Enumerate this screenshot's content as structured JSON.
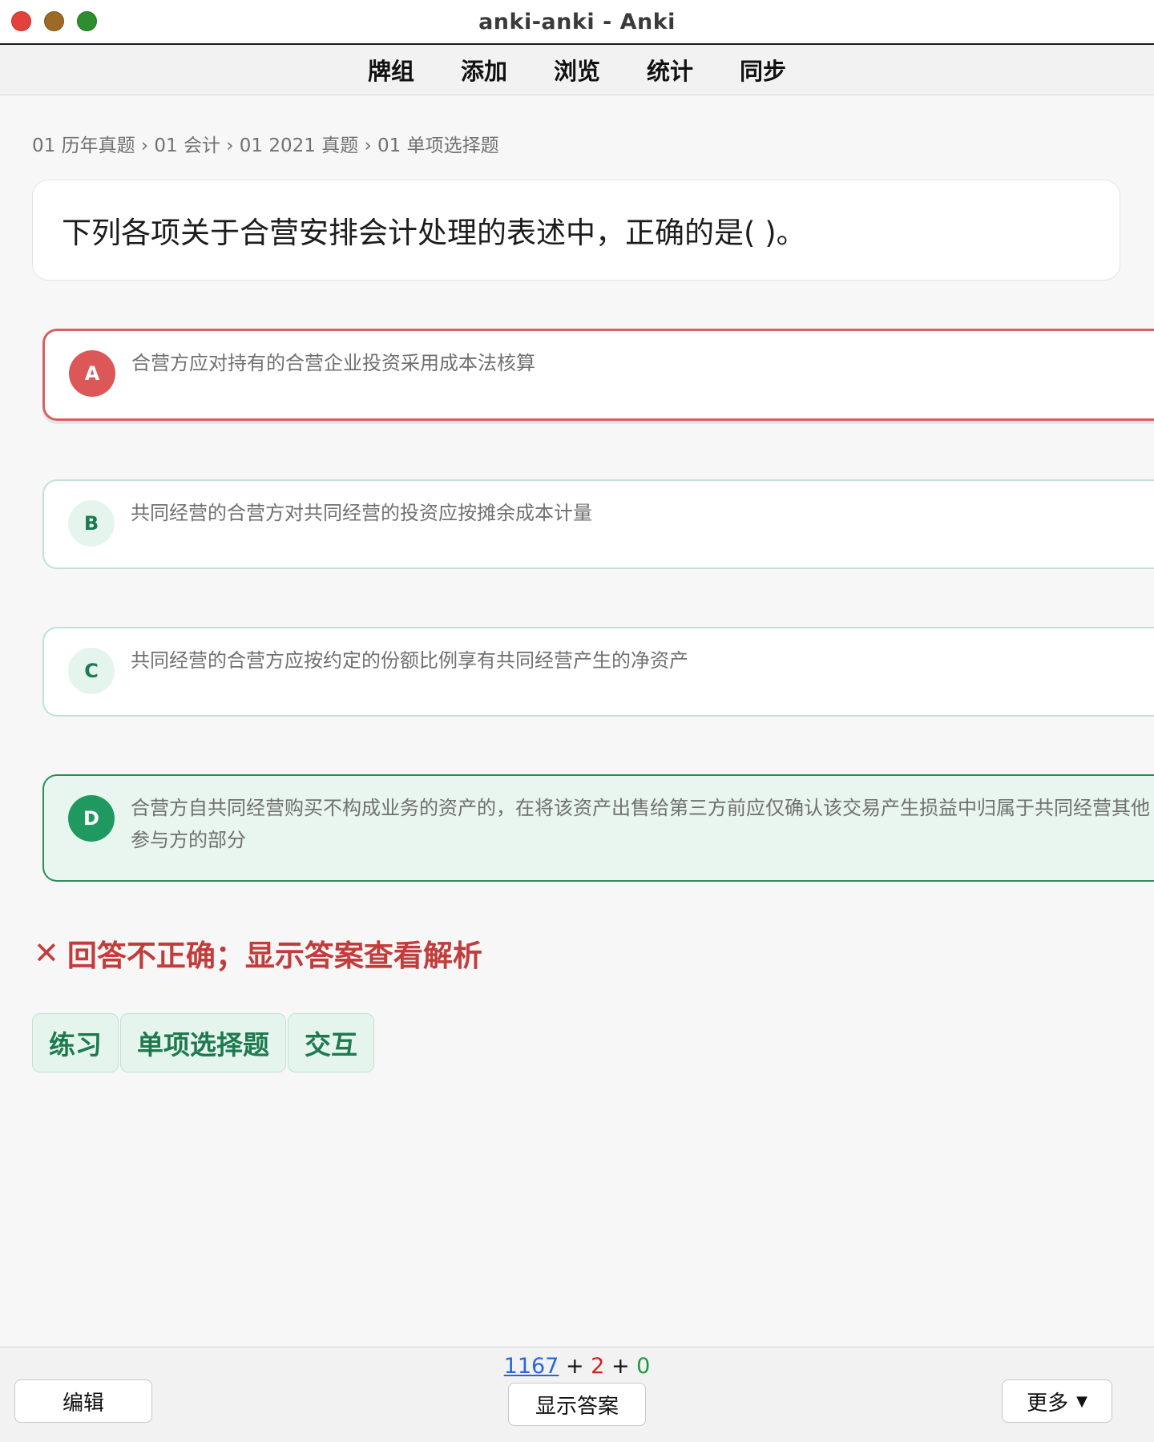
{
  "window": {
    "title": "anki-anki - Anki"
  },
  "nav": {
    "items": [
      "牌组",
      "添加",
      "浏览",
      "统计",
      "同步"
    ]
  },
  "breadcrumb": "01 历年真题 › 01 会计 › 01 2021 真题 › 01 单项选择题",
  "question": "下列各项关于合营安排会计处理的表述中，正确的是( )。",
  "options": [
    {
      "letter": "A",
      "text": "合营方应对持有的合营企业投资采用成本法核算",
      "state": "selected-wrong"
    },
    {
      "letter": "B",
      "text": "共同经营的合营方对共同经营的投资应按摊余成本计量",
      "state": "unselected"
    },
    {
      "letter": "C",
      "text": "共同经营的合营方应按约定的份额比例享有共同经营产生的净资产",
      "state": "unselected"
    },
    {
      "letter": "D",
      "text": "合营方自共同经营购买不构成业务的资产的，在将该资产出售给第三方前应仅确认该交易产生损益中归属于共同经营其他参与方的部分",
      "state": "correct"
    }
  ],
  "result": {
    "icon": "✕",
    "text": "回答不正确；显示答案查看解析"
  },
  "tags": [
    "练习",
    "单项选择题",
    "交互"
  ],
  "bottom": {
    "counts": {
      "new": "1167",
      "learn": "2",
      "review": "0",
      "separator": "+"
    },
    "edit_label": "编辑",
    "show_answer_label": "显示答案",
    "more_label": "更多",
    "more_caret": "▼"
  },
  "colors": {
    "wrong": "#d96060",
    "correct": "#2e8a5c",
    "tag_bg": "#e5f5ee"
  }
}
